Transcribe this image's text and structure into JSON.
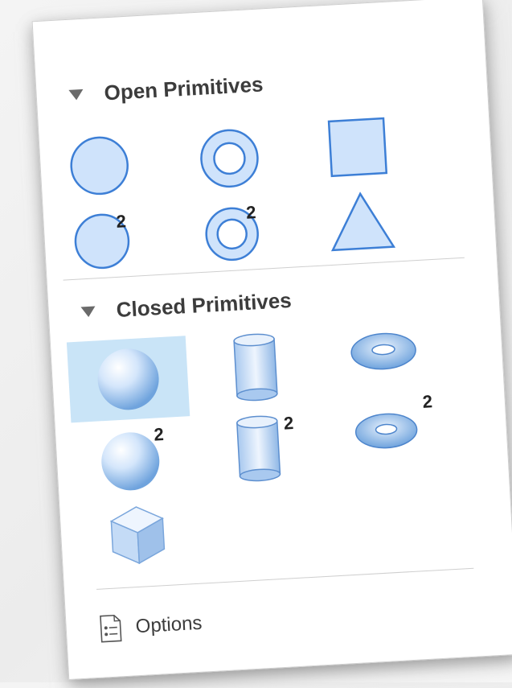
{
  "sections": {
    "open": {
      "title": "Open Primitives"
    },
    "closed": {
      "title": "Closed Primitives"
    }
  },
  "items": {
    "circle_badge": "2",
    "ring_badge": "2",
    "sphere_badge": "2",
    "cylinder_badge": "2",
    "torus_badge": "2"
  },
  "footer": {
    "options_label": "Options"
  },
  "colors": {
    "shape_fill": "#cfe3fb",
    "shape_stroke": "#3d7fd6",
    "selected_bg": "#c9e4f7"
  }
}
